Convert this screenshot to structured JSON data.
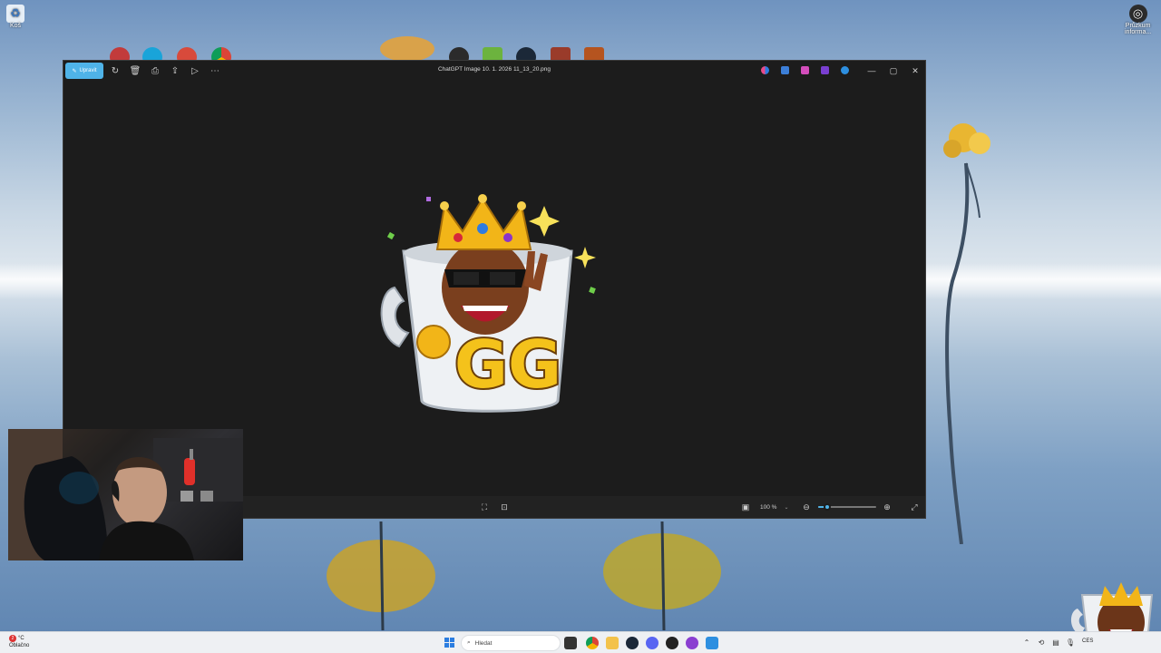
{
  "desktop": {
    "recycle_bin_label": "Koš",
    "top_right_icon_label_line1": "Průzkum",
    "top_right_icon_label_line2": "informa..."
  },
  "viewer": {
    "edit_label": "Upravit",
    "title": "ChatGPT Image 10. 1. 2026 11_13_20.png",
    "zoom_value": "100 %",
    "zoom_level_percent": 15,
    "image": {
      "caption": "GG"
    }
  },
  "taskbar": {
    "weather_badge": "2",
    "weather_temp": "°C",
    "weather_condition": "Oblačno",
    "search_placeholder": "Hledat",
    "tray_text": "CES"
  },
  "colors": {
    "accent": "#4fb3e8",
    "window_bg": "#1c1c1c",
    "taskbar_bg": "#eef0f3"
  }
}
